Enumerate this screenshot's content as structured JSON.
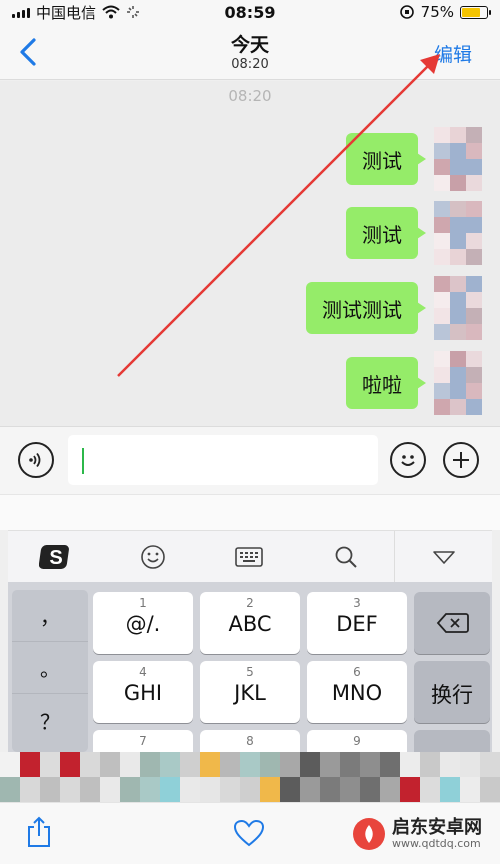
{
  "status_bar": {
    "carrier": "中国电信",
    "time": "08:59",
    "battery": "75%",
    "battery_level": 0.75
  },
  "nav": {
    "back_icon": "chevron-left-icon",
    "title": "今天",
    "subtitle": "08:20",
    "edit_label": "编辑"
  },
  "chat": {
    "timestamp": "08:20",
    "messages": [
      {
        "text": "测试"
      },
      {
        "text": "测试"
      },
      {
        "text": "测试测试"
      },
      {
        "text": "啦啦"
      }
    ]
  },
  "input_bar": {
    "voice_icon": "voice-icon",
    "emoji_icon": "emoji-icon",
    "plus_icon": "plus-icon"
  },
  "keyboard": {
    "toolbar": [
      "sogou-logo-icon",
      "emoji-icon",
      "keyboard-icon",
      "search-icon",
      "collapse-icon"
    ],
    "punctuation": [
      "，",
      "。",
      "？"
    ],
    "keys": [
      {
        "num": "1",
        "label": "@/."
      },
      {
        "num": "2",
        "label": "ABC"
      },
      {
        "num": "3",
        "label": "DEF"
      },
      {
        "num": "4",
        "label": "GHI"
      },
      {
        "num": "5",
        "label": "JKL"
      },
      {
        "num": "6",
        "label": "MNO"
      },
      {
        "num": "7",
        "label": ""
      },
      {
        "num": "8",
        "label": ""
      },
      {
        "num": "9",
        "label": ""
      }
    ],
    "newline_label": "换行"
  },
  "watermark": {
    "name": "启东安卓网",
    "url": "www.qdtdq.com"
  },
  "colors": {
    "bubble": "#95ec69",
    "accent": "#1f7ae6",
    "arrow": "#e53935"
  }
}
